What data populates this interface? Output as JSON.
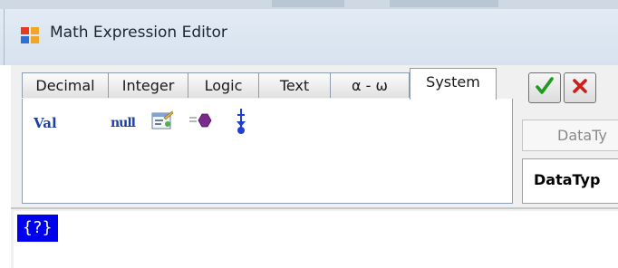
{
  "window": {
    "title": "Math Expression Editor"
  },
  "tabs": [
    {
      "label": "Decimal",
      "active": false
    },
    {
      "label": "Integer",
      "active": false
    },
    {
      "label": "Logic",
      "active": false
    },
    {
      "label": "Text",
      "active": false
    },
    {
      "label": "α - ω",
      "active": false
    },
    {
      "label": "System",
      "active": true
    }
  ],
  "system_panel": {
    "val_label": "Val",
    "null_label": "null",
    "icons": [
      "properties-icon",
      "purple-hexagon-icon",
      "blue-pin-icon"
    ]
  },
  "actions": {
    "ok_icon": "checkmark-icon",
    "cancel_icon": "x-icon",
    "ok_color": "#1e9a1e",
    "cancel_color": "#d11a1a"
  },
  "right_panel": {
    "datatype_field": "DataTy",
    "datatype_header": "DataTyp"
  },
  "editor": {
    "token": "{?}",
    "token_bg": "#0000f0"
  }
}
